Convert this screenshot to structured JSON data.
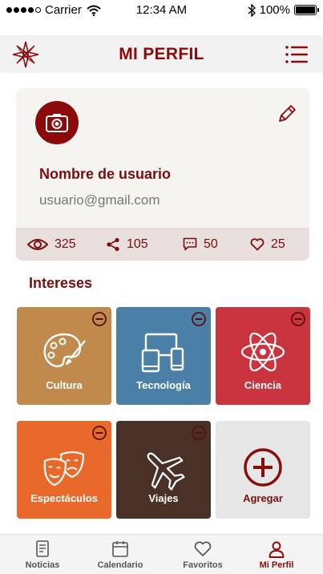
{
  "status_bar": {
    "carrier": "Carrier",
    "time": "12:34 AM",
    "battery": "100%",
    "signal_icon": "signal-dots-icon",
    "wifi_icon": "wifi-icon",
    "bluetooth_icon": "bluetooth-icon"
  },
  "nav": {
    "title": "MI PERFIL",
    "logo_icon": "compass-rose-icon",
    "menu_icon": "list-menu-icon"
  },
  "profile": {
    "username": "Nombre de usuario",
    "email": "usuario@gmail.com",
    "avatar_icon": "camera-icon",
    "edit_icon": "pencil-icon",
    "stats": [
      {
        "icon": "eye-icon",
        "value": "325"
      },
      {
        "icon": "share-icon",
        "value": "105"
      },
      {
        "icon": "comment-icon",
        "value": "50"
      },
      {
        "icon": "heart-icon",
        "value": "25"
      }
    ]
  },
  "interests": {
    "title": "Intereses",
    "items": [
      {
        "label": "Cultura",
        "icon": "palette-icon",
        "color": "#c08a4c"
      },
      {
        "label": "Tecnología",
        "icon": "devices-icon",
        "color": "#4a7fa8"
      },
      {
        "label": "Ciencia",
        "icon": "atom-icon",
        "color": "#c9343f"
      },
      {
        "label": "Espectáculos",
        "icon": "theater-masks-icon",
        "color": "#e8692a"
      },
      {
        "label": "Viajes",
        "icon": "airplane-icon",
        "color": "#4a3128"
      },
      {
        "label": "Agregar",
        "icon": "plus-circle-icon",
        "color": "#e6e6e6"
      }
    ]
  },
  "tabs": [
    {
      "label": "Noticias",
      "icon": "newspaper-icon",
      "active": false
    },
    {
      "label": "Calendario",
      "icon": "calendar-icon",
      "active": false
    },
    {
      "label": "Favoritos",
      "icon": "heart-icon",
      "active": false
    },
    {
      "label": "Mi Perfil",
      "icon": "user-icon",
      "active": true
    }
  ],
  "colors": {
    "brand": "#8b0b0b",
    "card_bg": "#f6f4f1",
    "stats_bg": "#e8dedb"
  }
}
